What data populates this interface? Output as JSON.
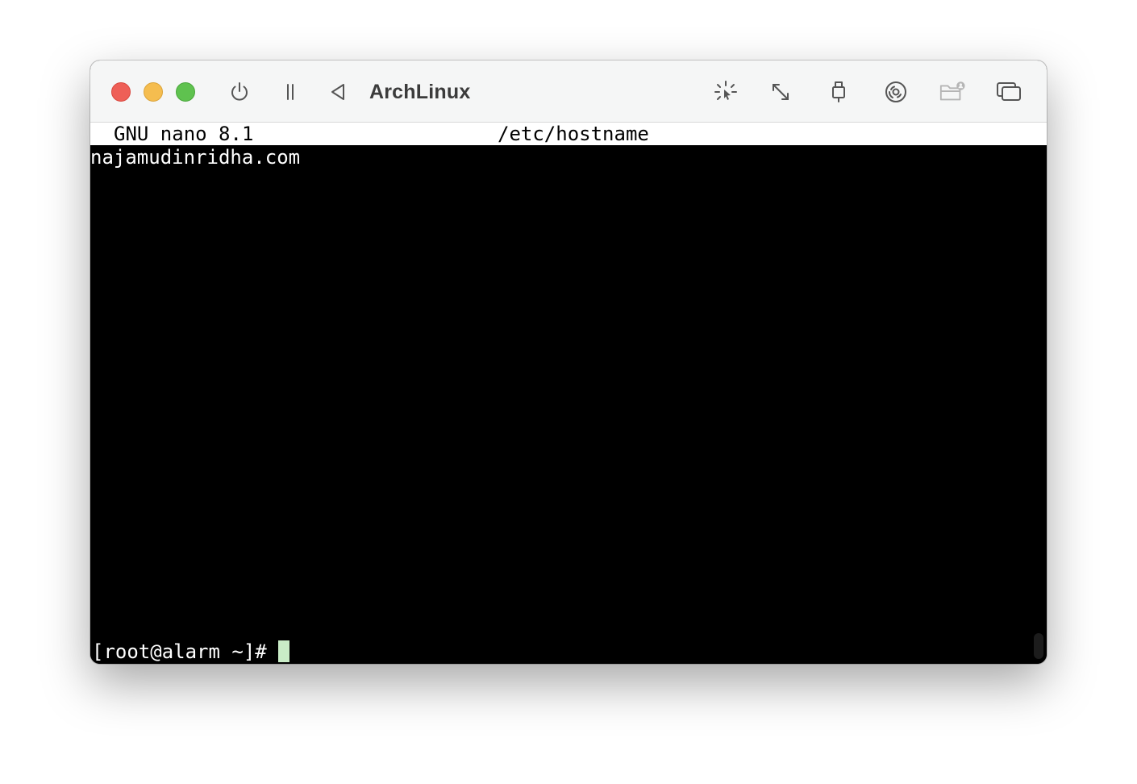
{
  "window": {
    "title": "ArchLinux"
  },
  "toolbar": {
    "icons": [
      "power-icon",
      "pause-icon",
      "back-icon",
      "capture-mouse-icon",
      "resize-icon",
      "usb-icon",
      "disc-icon",
      "shared-folder-icon",
      "windows-icon"
    ]
  },
  "terminal": {
    "nano_version": "GNU nano 8.1",
    "nano_filename": "/etc/hostname",
    "file_content": "najamudinridha.com",
    "prompt": "[root@alarm ~]#"
  },
  "colors": {
    "close": "#ee5f57",
    "minimize": "#f5bd4f",
    "maximize": "#5fc24f",
    "terminal_bg": "#000000",
    "terminal_fg": "#ffffff",
    "cursor": "#c9ecc7"
  }
}
